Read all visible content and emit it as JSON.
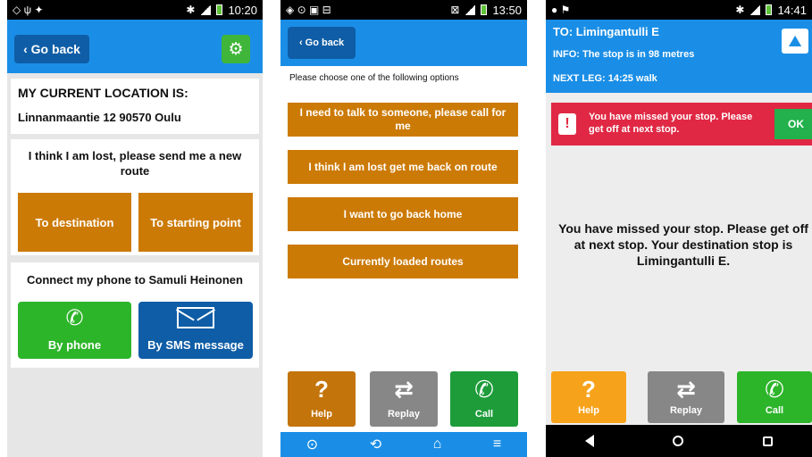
{
  "screen1": {
    "status_time": "10:20",
    "back_label": "‹ Go back",
    "location_title": "MY CURRENT LOCATION IS:",
    "location_address": "Linnanmaantie 12 90570 Oulu",
    "lost_text": "I think I am lost, please send me a new route",
    "to_destination": "To destination",
    "to_starting_point": "To starting point",
    "connect_text": "Connect my phone to Samuli Heinonen",
    "by_phone": "By phone",
    "by_sms": "By SMS message",
    "colors": {
      "header": "#1a8ee6",
      "orange": "#cc7a06",
      "green": "#2db52a",
      "blue": "#0f5da6"
    }
  },
  "screen2": {
    "status_time": "13:50",
    "back_label": "‹ Go back",
    "prompt": "Please choose one of the following options",
    "options": [
      "I need to talk to someone, please call for me",
      "I think I am lost get me back on route",
      "I want to go back home",
      "Currently loaded routes"
    ],
    "help": "Help",
    "replay": "Replay",
    "call": "Call"
  },
  "screen3": {
    "status_time": "14:41",
    "to_line": "TO: Limingantulli E",
    "info_line": "INFO: The stop is in  98 metres",
    "next_line": "NEXT LEG: 14:25 walk",
    "alert_text": "You have missed your stop. Please get off at next stop.",
    "ok": "OK",
    "message": "You have missed your stop. Please get off at next stop. Your destination stop is Limingantulli E.",
    "help": "Help",
    "replay": "Replay",
    "call": "Call",
    "colors": {
      "alert": "#e02844",
      "ok": "#22b14c",
      "help": "#f7a21b"
    }
  }
}
